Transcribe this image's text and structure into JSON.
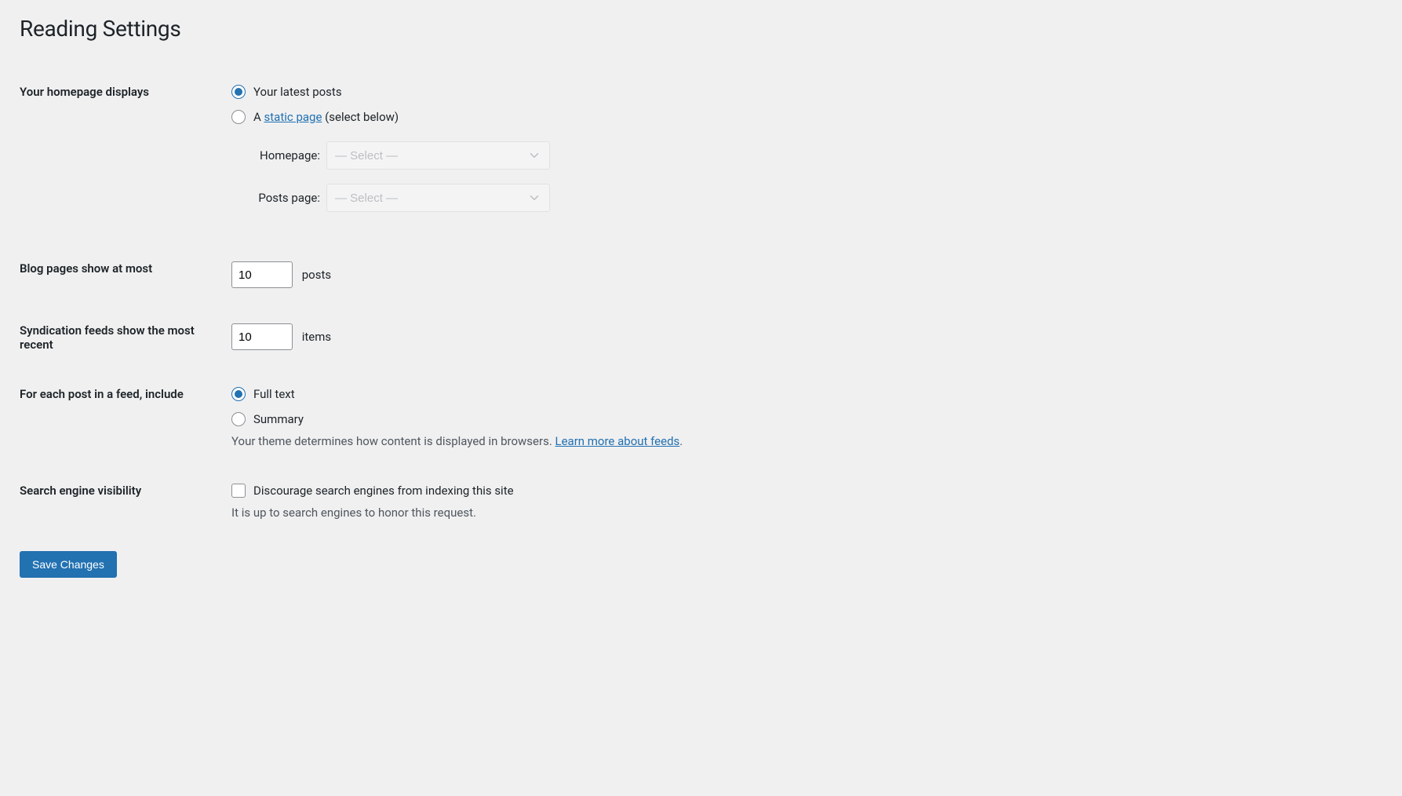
{
  "page_title": "Reading Settings",
  "homepage_displays": {
    "label": "Your homepage displays",
    "latest_posts_label": "Your latest posts",
    "static_page_prefix": "A ",
    "static_page_link": "static page",
    "static_page_suffix": " (select below)",
    "homepage_select_label": "Homepage:",
    "posts_page_select_label": "Posts page:",
    "select_placeholder": "— Select —"
  },
  "blog_pages": {
    "label": "Blog pages show at most",
    "value": "10",
    "suffix": "posts"
  },
  "syndication": {
    "label": "Syndication feeds show the most recent",
    "value": "10",
    "suffix": "items"
  },
  "feed_include": {
    "label": "For each post in a feed, include",
    "full_text_label": "Full text",
    "summary_label": "Summary",
    "description": "Your theme determines how content is displayed in browsers. ",
    "link_text": "Learn more about feeds",
    "suffix": "."
  },
  "search_visibility": {
    "label": "Search engine visibility",
    "checkbox_label": "Discourage search engines from indexing this site",
    "description": "It is up to search engines to honor this request."
  },
  "save_button": "Save Changes"
}
